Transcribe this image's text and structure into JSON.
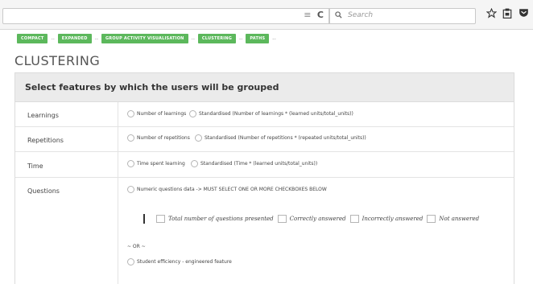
{
  "browser": {
    "search_placeholder": "Search",
    "url_icons": [
      "≡",
      "C"
    ],
    "search_icon": "magnifier-icon",
    "toolbar_icons": [
      "star-icon",
      "clipboard-icon",
      "pocket-icon"
    ]
  },
  "breadcrumbs": [
    "COMPACT",
    "EXPANDED",
    "GROUP ACTIVITY VISUALISATION",
    "CLUSTERING",
    "PATHS"
  ],
  "breadcrumb_separator": "--",
  "page_title": "CLUSTERING",
  "panel": {
    "heading": "Select features by which the users will be grouped",
    "rows": [
      {
        "label": "Learnings",
        "options": [
          "Number of learnings",
          "Standardised (Number of learnings * (learned units/total_units))"
        ]
      },
      {
        "label": "Repetitions",
        "options": [
          "Number of repetitions",
          "Standardised (Number of repetitions * (repeated units/total_units))"
        ]
      },
      {
        "label": "Time",
        "options": [
          "Time spent learning",
          "Standardised (Time * (learned units/total_units))"
        ]
      },
      {
        "label": "Questions",
        "options": [
          "Numeric questions data -> MUST SELECT ONE OR MORE CHECKBOXES BELOW"
        ],
        "checkboxes": [
          "Total number of questions presented",
          "Correctly answered",
          "Incorrectly answered",
          "Not answered"
        ],
        "or_text": "~ OR ~",
        "extra_option": "Student efficiency - engineered feature"
      }
    ]
  },
  "colors": {
    "breadcrumb_bg": "#5cb85c",
    "panel_header_bg": "#ebebeb"
  }
}
